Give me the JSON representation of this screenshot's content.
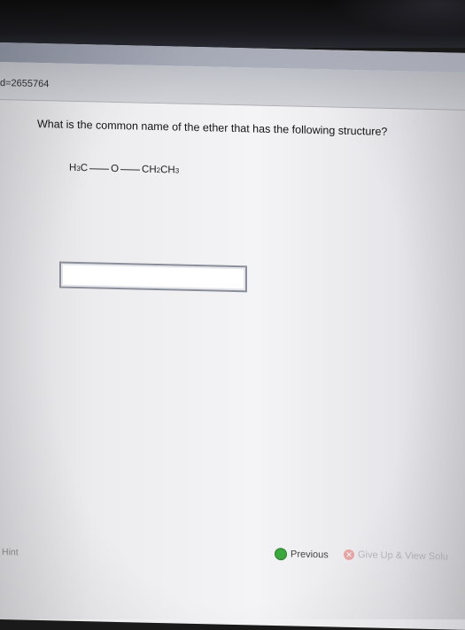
{
  "browser": {
    "url_fragment": "d=2655764"
  },
  "question": {
    "prompt": "What is the common name of the ether that has the following structure?",
    "structure": {
      "left_group": "H",
      "left_sub": "3",
      "left_tail": "C",
      "center_atom": "O",
      "right_group_a": "CH",
      "right_sub_a": "2",
      "right_group_b": "CH",
      "right_sub_b": "3"
    }
  },
  "answer": {
    "value": "",
    "placeholder": ""
  },
  "footer": {
    "hint_label": "Hint",
    "previous_label": "Previous",
    "give_up_label": "Give Up & View Solu"
  }
}
